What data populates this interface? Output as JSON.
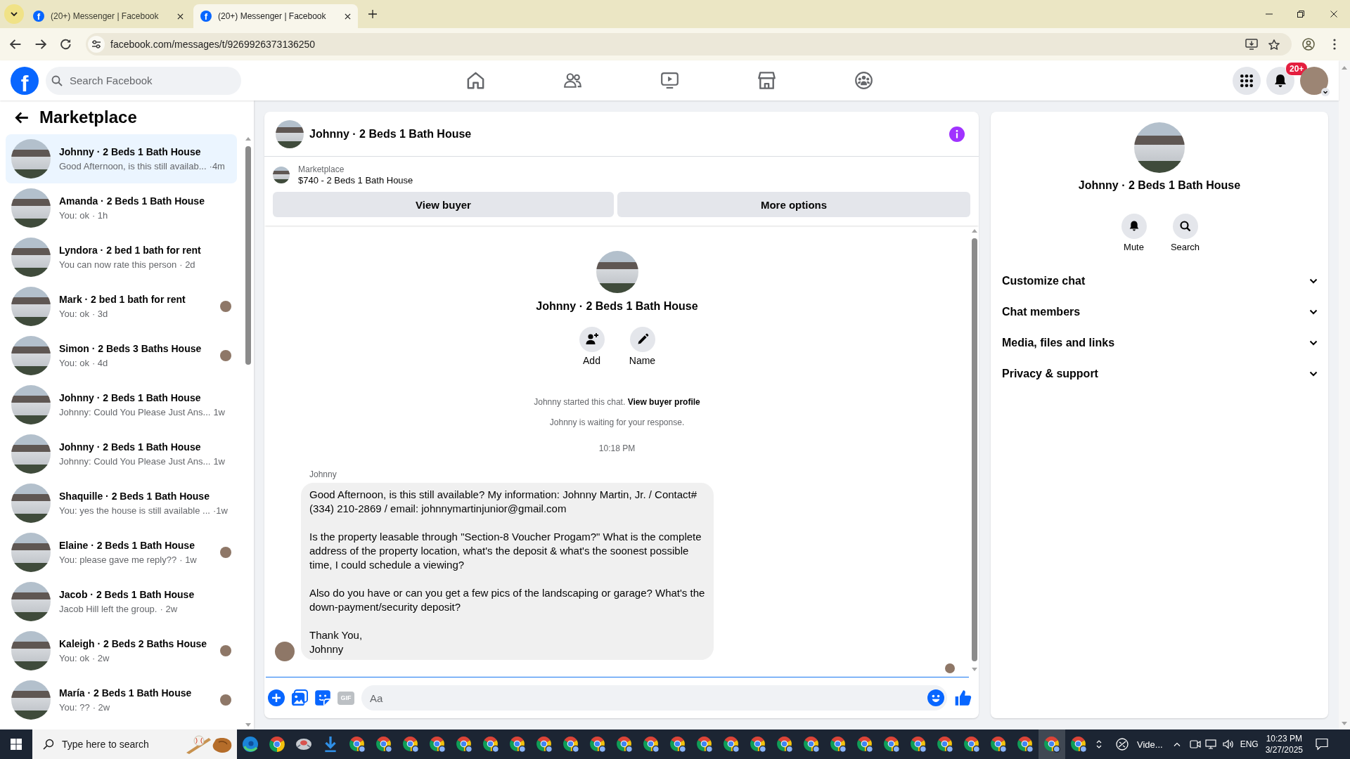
{
  "browser": {
    "tabs": [
      {
        "favicon": "f",
        "title": "(20+) Messenger | Facebook",
        "selected": false
      },
      {
        "favicon": "f",
        "title": "(20+) Messenger | Facebook",
        "selected": true
      }
    ],
    "url": "facebook.com/messages/t/9269926373136250"
  },
  "header": {
    "logo": "f",
    "search_placeholder": "Search Facebook",
    "nav": [
      {
        "kind": "home",
        "selected": false
      },
      {
        "kind": "friends",
        "selected": false
      },
      {
        "kind": "video",
        "selected": false
      },
      {
        "kind": "marketplace",
        "selected": false
      },
      {
        "kind": "groups",
        "selected": false
      }
    ],
    "notification_badge": "20+"
  },
  "sidebar": {
    "title": "Marketplace",
    "conversations": [
      {
        "name": "Johnny · 2 Beds 1 Bath House",
        "preview": "Good Afternoon, is this still availab...",
        "time": "·4m",
        "seen": false,
        "selected": true
      },
      {
        "name": "Amanda · 2 Beds 1 Bath House",
        "preview": "You: ok",
        "time": "· 1h",
        "seen": false,
        "selected": false
      },
      {
        "name": "Lyndora · 2 bed 1 bath for rent",
        "preview": "You can now rate this person",
        "time": "· 2d",
        "seen": false,
        "selected": false
      },
      {
        "name": "Mark · 2 bed 1 bath for rent",
        "preview": "You: ok",
        "time": "· 3d",
        "seen": true,
        "selected": false
      },
      {
        "name": "Simon · 2 Beds 3 Baths House",
        "preview": "You: ok",
        "time": "· 4d",
        "seen": true,
        "selected": false
      },
      {
        "name": "Johnny · 2 Beds 1 Bath House",
        "preview": "Johnny: Could You Please Just Ans...",
        "time": "1w",
        "seen": false,
        "selected": false
      },
      {
        "name": "Johnny · 2 Beds 1 Bath House",
        "preview": "Johnny: Could You Please Just Ans...",
        "time": "1w",
        "seen": false,
        "selected": false
      },
      {
        "name": "Shaquille · 2 Beds 1 Bath House",
        "preview": "You: yes the house is still available ...",
        "time": "·1w",
        "seen": false,
        "selected": false
      },
      {
        "name": "Elaine · 2 Beds 1 Bath House",
        "preview": "You: please gave me reply??",
        "time": "· 1w",
        "seen": true,
        "selected": false
      },
      {
        "name": "Jacob · 2 Beds 1 Bath House",
        "preview": "Jacob Hill left the group.",
        "time": "· 2w",
        "seen": false,
        "selected": false
      },
      {
        "name": "Kaleigh · 2 Beds 2 Baths House",
        "preview": "You: ok",
        "time": "· 2w",
        "seen": true,
        "selected": false
      },
      {
        "name": "María · 2 Beds 1 Bath House",
        "preview": "You: ??",
        "time": "· 2w",
        "seen": true,
        "selected": false
      }
    ]
  },
  "chat": {
    "title": "Johnny · 2 Beds 1 Bath House",
    "details_open": true,
    "listing": {
      "label": "Marketplace",
      "title": "$740 - 2 Beds 1 Bath House"
    },
    "buttons": [
      "View buyer",
      "More options"
    ],
    "intro": {
      "name": "Johnny · 2 Beds 1 Bath House",
      "actions": [
        {
          "kind": "add",
          "label": "Add"
        },
        {
          "kind": "name",
          "label": "Name"
        }
      ]
    },
    "notice": {
      "text": "Johnny started this chat.",
      "link": "View buyer profile"
    },
    "status": "Johnny is waiting for your response.",
    "timestamp": "10:18 PM",
    "message": {
      "sender": "Johnny",
      "paragraphs": [
        "Good Afternoon, is this still available? My information: Johnny Martin, Jr. / Contact# (334) 210-2869 / email: johnnymartinjunior@gmail.com",
        "Is the property leasable through \"Section-8 Voucher Progam?\" What is the complete address of the property location, what's the deposit & what's the soonest possible time, I could schedule a viewing?",
        "Also do you have or can you get a few pics of the landscaping or garage? What's the down-payment/security deposit?",
        "Thank You,\nJohnny"
      ],
      "seen": true
    },
    "composer": {
      "gif": "GIF",
      "placeholder": "Aa"
    }
  },
  "details": {
    "name": "Johnny · 2 Beds 1 Bath House",
    "actions": [
      {
        "kind": "mute",
        "label": "Mute"
      },
      {
        "kind": "search",
        "label": "Search"
      }
    ],
    "sections": [
      {
        "label": "Customize chat",
        "expanded": false
      },
      {
        "label": "Chat members",
        "expanded": false
      },
      {
        "label": "Media, files and links",
        "expanded": false
      },
      {
        "label": "Privacy & support",
        "expanded": false
      }
    ]
  },
  "taskbar": {
    "search_placeholder": "Type here to search",
    "apps": [
      {
        "kind": "edge",
        "selected": false
      },
      {
        "kind": "chrome",
        "selected": false
      },
      {
        "kind": "app",
        "selected": false
      },
      {
        "kind": "download",
        "selected": false
      },
      {
        "kind": "chrome-profile",
        "selected": false
      },
      {
        "kind": "chrome-profile",
        "selected": false
      },
      {
        "kind": "chrome-profile",
        "selected": false
      },
      {
        "kind": "chrome-profile",
        "selected": false
      },
      {
        "kind": "chrome-profile",
        "selected": false
      },
      {
        "kind": "chrome-profile",
        "selected": false
      },
      {
        "kind": "chrome-profile",
        "selected": false
      },
      {
        "kind": "chrome-profile",
        "selected": false
      },
      {
        "kind": "chrome-profile",
        "selected": false
      },
      {
        "kind": "chrome-profile",
        "selected": false
      },
      {
        "kind": "chrome-profile",
        "selected": false
      },
      {
        "kind": "chrome-profile",
        "selected": false
      },
      {
        "kind": "chrome-profile",
        "selected": false
      },
      {
        "kind": "chrome-profile",
        "selected": false
      },
      {
        "kind": "chrome-profile",
        "selected": false
      },
      {
        "kind": "chrome-profile",
        "selected": false
      },
      {
        "kind": "chrome-profile",
        "selected": false
      },
      {
        "kind": "chrome-profile",
        "selected": false
      },
      {
        "kind": "chrome-profile",
        "selected": false
      },
      {
        "kind": "chrome-profile",
        "selected": false
      },
      {
        "kind": "chrome-profile",
        "selected": false
      },
      {
        "kind": "chrome-profile",
        "selected": false
      },
      {
        "kind": "chrome-profile",
        "selected": false
      },
      {
        "kind": "chrome-profile",
        "selected": false
      },
      {
        "kind": "chrome-profile",
        "selected": false
      },
      {
        "kind": "chrome-profile",
        "selected": false
      },
      {
        "kind": "chrome-profile",
        "selected": true
      },
      {
        "kind": "chrome-profile",
        "selected": false
      }
    ],
    "pinned_label": "Vide...",
    "language": "ENG",
    "time": "10:23 PM",
    "date": "3/27/2025"
  }
}
